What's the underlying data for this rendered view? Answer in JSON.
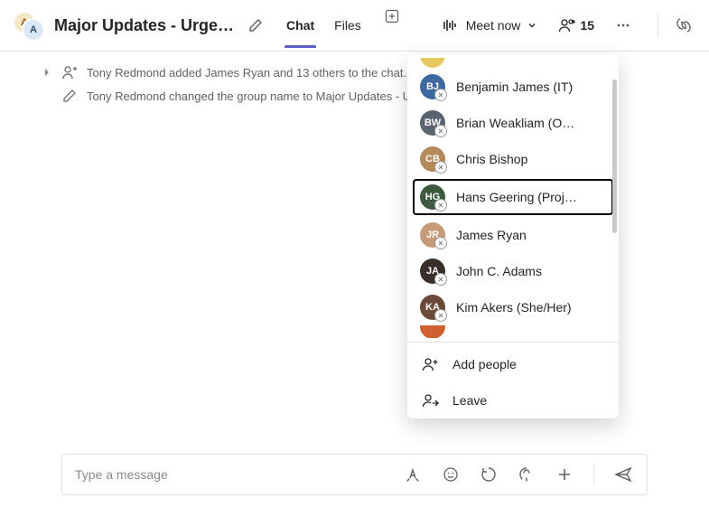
{
  "header": {
    "title": "Major Updates - Urge…",
    "avatars": [
      "A",
      "A"
    ],
    "tabs": {
      "chat": "Chat",
      "files": "Files"
    },
    "meet_now": "Meet now",
    "participant_count": "15"
  },
  "system_messages": [
    "Tony Redmond added James Ryan and 13 others to the chat.",
    "Tony Redmond changed the group name to Major Updates - Urgent"
  ],
  "people_popover": {
    "items": [
      {
        "name": "Benjamin James (IT)",
        "color": "#3c6aa0",
        "initials": "BJ"
      },
      {
        "name": "Brian Weakliam (O…",
        "color": "#5a6470",
        "initials": "BW"
      },
      {
        "name": "Chris Bishop",
        "color": "#b48a5a",
        "initials": "CB"
      },
      {
        "name": "Hans Geering (Proj…",
        "color": "#3e5a3e",
        "initials": "HG",
        "highlighted": true
      },
      {
        "name": "James Ryan",
        "color": "#c79b7a",
        "initials": "JR"
      },
      {
        "name": "John C. Adams",
        "color": "#3a2e2a",
        "initials": "JA"
      },
      {
        "name": "Kim Akers (She/Her)",
        "color": "#6b4a3a",
        "initials": "KA"
      }
    ],
    "add_people": "Add people",
    "leave": "Leave"
  },
  "composer": {
    "placeholder": "Type a message"
  },
  "icons": {
    "edit": "edit-icon",
    "add_tab": "plus-box-icon",
    "camera": "camera-lines-icon",
    "chevron_down": "chevron-down-icon",
    "people_add": "people-add-icon",
    "more": "more-icon",
    "copilot": "copilot-icon",
    "caret": "caret-right-icon",
    "person_add": "person-add-icon",
    "pencil": "pencil-icon",
    "leave": "leave-icon",
    "format": "format-icon",
    "emoji": "emoji-icon",
    "loop": "loop-icon",
    "stream": "stream-icon",
    "plus": "plus-icon",
    "send": "send-icon"
  }
}
